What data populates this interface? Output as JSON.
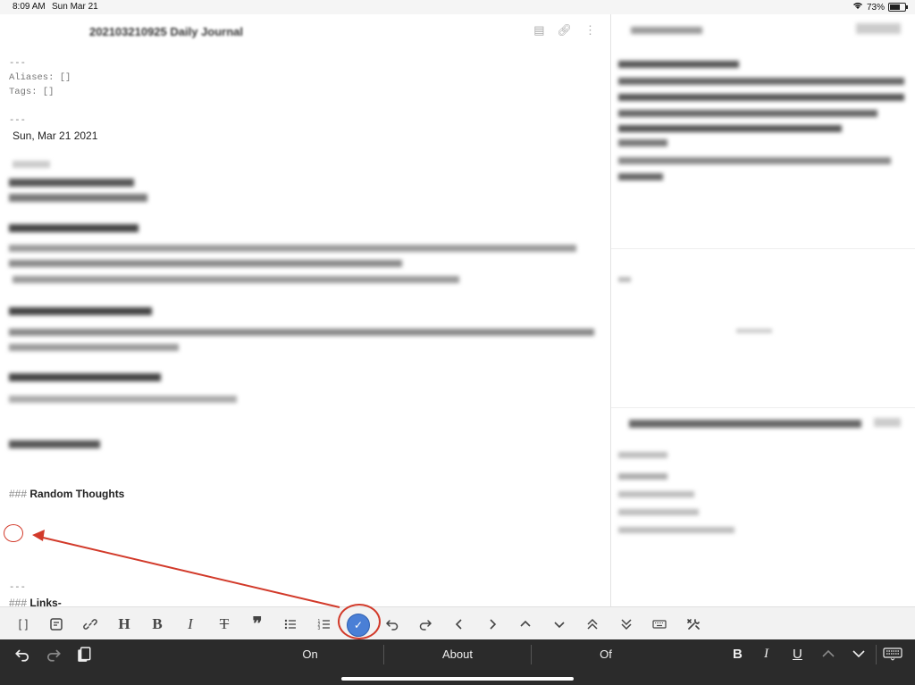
{
  "status": {
    "time": "8:09 AM",
    "date": "Sun Mar 21",
    "battery": "73%",
    "battery_level": 0.73
  },
  "editor": {
    "title": "202103210925 Daily Journal",
    "frontmatter_sep": "---",
    "aliases": "Aliases: []",
    "tags": "Tags: []",
    "sep2": "---",
    "date_line": "Sun, Mar 21 2021",
    "heading_hash": "###",
    "random_thoughts": "Random Thoughts",
    "sep3": "---",
    "links": "Links-"
  },
  "toolbar": {
    "buttons": [
      "[ ]",
      "note-icon",
      "link-icon",
      "H",
      "B",
      "I",
      "T",
      "❞",
      "bullets-icon",
      "numbered-icon",
      "check-icon",
      "undo-icon",
      "redo-icon",
      "‹",
      "›",
      "˄",
      "˅",
      "double-up-icon",
      "double-down-icon",
      "keyboard-icon",
      "tools-icon"
    ],
    "heading": "H",
    "bold": "B",
    "italic": "I",
    "strike": "T",
    "quote": "❞",
    "brackets": "[ ]",
    "check": "✓"
  },
  "keyboard": {
    "suggestions": [
      "On",
      "About",
      "Of"
    ],
    "bold": "B",
    "italic": "I",
    "underline": "U"
  },
  "colors": {
    "accent": "#4a7fd6",
    "annotation": "#d23a2a",
    "keyboard_bg": "#2b2b2b"
  }
}
